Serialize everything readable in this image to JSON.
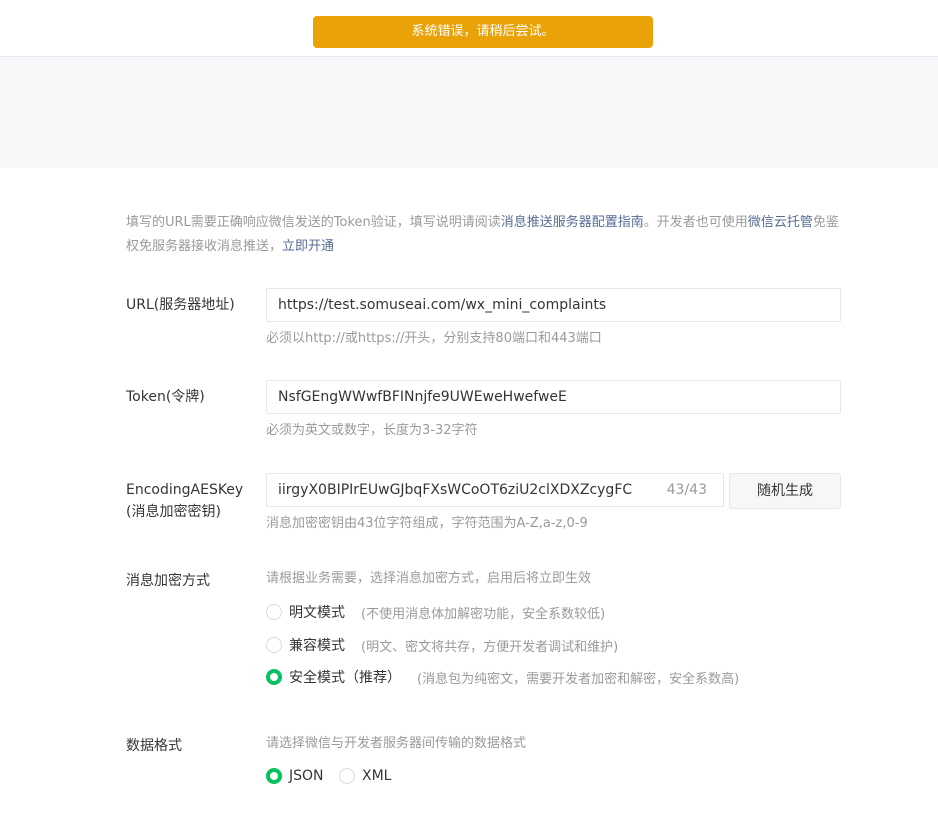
{
  "toast": {
    "message": "系统错误，请稍后尝试。"
  },
  "intro": {
    "part1": "填写的URL需要正确响应微信发送的Token验证，填写说明请阅读",
    "guide_link": "消息推送服务器配置指南",
    "part2": "。开发者也可使用",
    "cloud_link": "微信云托管",
    "part3": "免鉴权免服务器接收消息推送，",
    "enable_link": "立即开通"
  },
  "url": {
    "label": "URL(服务器地址)",
    "value": "https://test.somuseai.com/wx_mini_complaints",
    "hint": "必须以http://或https://开头，分别支持80端口和443端口"
  },
  "token": {
    "label": "Token(令牌)",
    "value": "NsfGEngWWwfBFINnjfe9UWEweHwefweE",
    "hint": "必须为英文或数字，长度为3-32字符"
  },
  "aes": {
    "label_line1": "EncodingAESKey",
    "label_line2": "(消息加密密钥)",
    "value": "iirgyX0BIPIrEUwGJbqFXsWCoOT6ziU2clXDXZcygFC",
    "counter": "43/43",
    "generate_button": "随机生成",
    "hint": "消息加密密钥由43位字符组成，字符范围为A-Z,a-z,0-9"
  },
  "encryption": {
    "label": "消息加密方式",
    "hint": "请根据业务需要，选择消息加密方式，启用后将立即生效",
    "options": [
      {
        "label": "明文模式",
        "desc": "(不使用消息体加解密功能，安全系数较低)",
        "checked": false
      },
      {
        "label": "兼容模式",
        "desc": "(明文、密文将共存，方便开发者调试和维护)",
        "checked": false
      },
      {
        "label": "安全模式（推荐）",
        "desc": "(消息包为纯密文，需要开发者加密和解密，安全系数高)",
        "checked": true
      }
    ]
  },
  "format": {
    "label": "数据格式",
    "hint": "请选择微信与开发者服务器间传输的数据格式",
    "options": [
      {
        "label": "JSON",
        "checked": true
      },
      {
        "label": "XML",
        "checked": false
      }
    ]
  },
  "colors": {
    "toast_bg": "#e9a208",
    "radio_checked": "#07c160",
    "link": "#576b95"
  }
}
